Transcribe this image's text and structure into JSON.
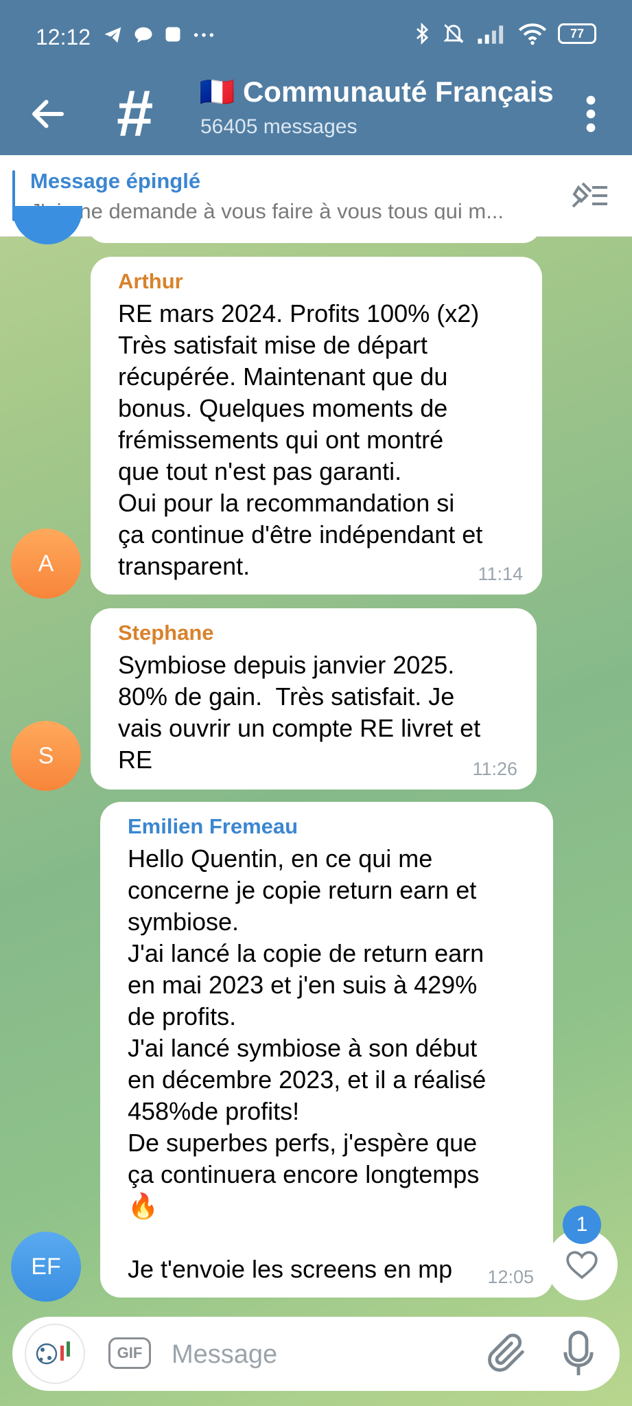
{
  "status_bar": {
    "time": "12:12",
    "left_icons": [
      "telegram-icon",
      "chat-bubble-icon",
      "square-icon",
      "more-dots-icon"
    ],
    "right_icons": [
      "bluetooth-icon",
      "mute-icon",
      "signal-icon",
      "wifi-icon"
    ],
    "battery": "77"
  },
  "header": {
    "flag": "🇫🇷",
    "title": "Communauté Français",
    "subtitle": "56405 messages"
  },
  "pinned": {
    "title": "Message épinglé",
    "text": "J'ai une demande à vous faire à vous tous qui m..."
  },
  "messages": [
    {
      "sender": "Arthur",
      "sender_color": "#d9822b",
      "avatar_initials": "A",
      "text": "RE mars 2024. Profits 100% (x2)\nTrès satisfait mise de départ\nrécupérée. Maintenant que du\nbonus. Quelques moments de\nfrémissements qui ont montré\nque tout n'est pas garanti.\nOui pour la recommandation si\nça continue d'être indépendant et\ntransparent.",
      "time": "11:14"
    },
    {
      "sender": "Stephane",
      "sender_color": "#d9822b",
      "avatar_initials": "S",
      "text": "Symbiose depuis janvier 2025.\n80% de gain.  Très satisfait. Je\nvais ouvrir un compte RE livret et\nRE",
      "time": "11:26"
    },
    {
      "sender": "Emilien Fremeau",
      "sender_color": "#3b86d1",
      "avatar_initials": "EF",
      "text": "Hello Quentin, en ce qui me\nconcerne je copie return earn et\nsymbiose.\nJ'ai lancé la copie de return earn\nen mai 2023 et j'en suis à 429%\nde profits.\nJ'ai lancé symbiose à son début\nen décembre 2023, et il a réalisé\n458%de profits!\nDe superbes perfs, j'espère que\nça continuera encore longtemps\n🔥\n\nJe t'envoie les screens en mp",
      "time": "12:05"
    }
  ],
  "reaction_badge": "1",
  "input": {
    "gif_label": "GIF",
    "placeholder": "Message"
  }
}
